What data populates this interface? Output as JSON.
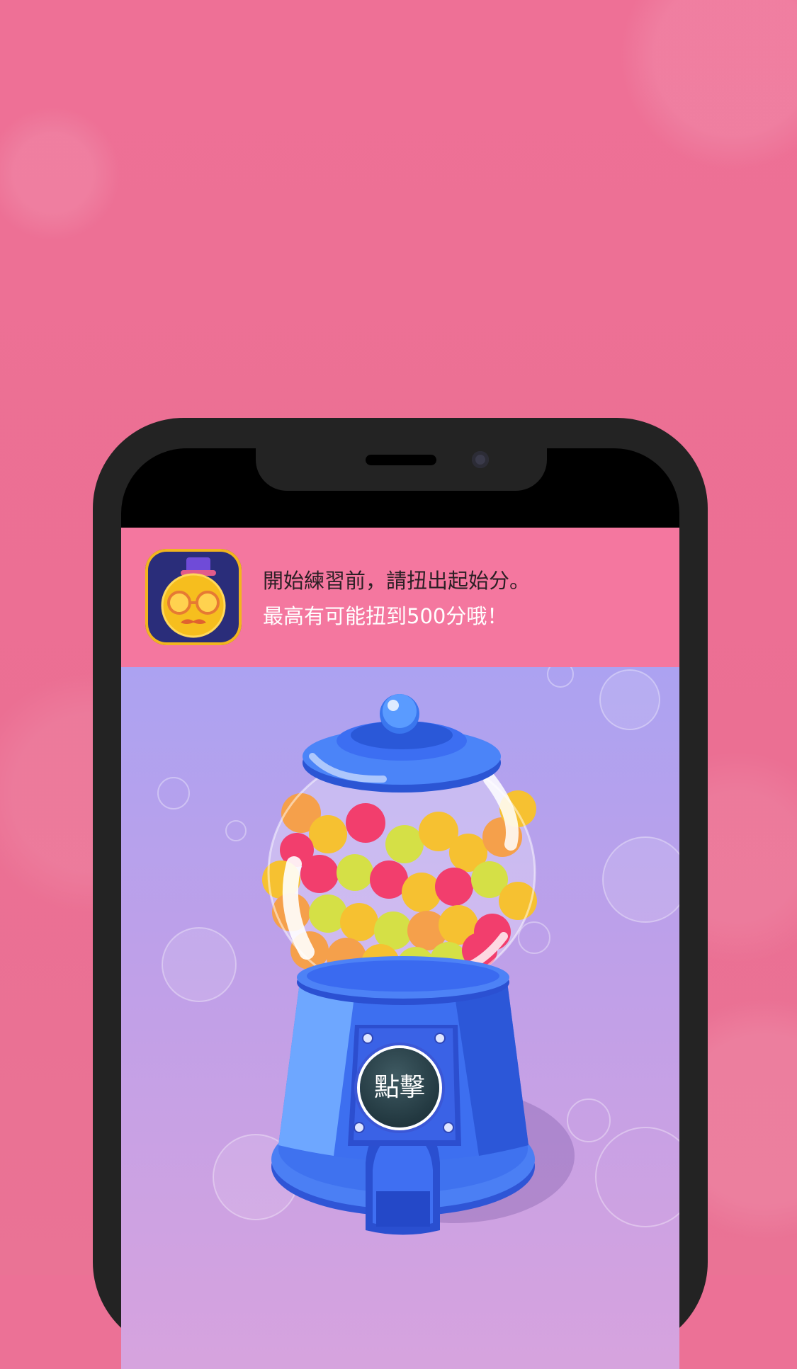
{
  "header": {
    "message_line1": "開始練習前，請扭出起始分。",
    "message_line2": "最高有可能扭到500分哦！"
  },
  "machine": {
    "button_label": "點擊"
  },
  "icons": [
    "app-mascot-icon",
    "speaker-icon",
    "camera-icon"
  ],
  "colors": {
    "background": "#ec7196",
    "header": "#f4779f",
    "phone_frame": "#232323",
    "machine_blue": "#3b6cf0"
  }
}
